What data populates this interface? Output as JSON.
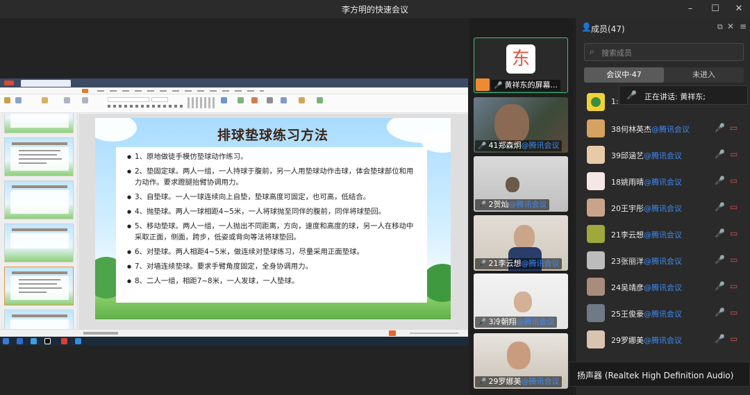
{
  "window": {
    "title": "李方明的快速会议",
    "minimize": "–",
    "maximize": "☐",
    "close": "✕"
  },
  "presentation": {
    "slide_title": "排球垫球练习方法",
    "bullets": [
      "1、原地做徒手模仿垫球动作练习。",
      "2、垫固定球。两人一组，一人持球于腹前，另一人用垫球动作击球，体会垫球部位和用力动作。要求蹬腿抬臂协调用力。",
      "3、自垫球。一人一球连续向上自垫，垫球高度可固定，也可高，低结合。",
      "4、抛垫球。两人一球相距4~5米，一人将球抛至同伴的腹前，同伴将球垫回。",
      "5、移动垫球。两人一组，一人抛出不同距离，方向，速度和高度的球，另一人在移动中采取正面，侧面，跨步，低姿或背向等法将球垫回。",
      "6、对垫球。两人相距4~5米，做连续对垫球练习，尽量采用正面垫球。",
      "7、对墙连续垫球。要求手臂角度固定，全身协调用力。",
      "8、二人一组，相距7~8米，一人发球，一人垫球。"
    ]
  },
  "video_tiles": [
    {
      "name": "黄祥东的屏幕...",
      "avatar_char": "东",
      "mic": "on",
      "active": true
    },
    {
      "name": "41郑森炯",
      "suffix": "@腾讯会议",
      "mic": "muted"
    },
    {
      "name": "2贺灿",
      "suffix": "@腾讯会议",
      "mic": "on"
    },
    {
      "name": "21李云想",
      "suffix": "@腾讯会议",
      "mic": "muted"
    },
    {
      "name": "3冷朝翔",
      "suffix": "@腾讯会议",
      "mic": "muted"
    },
    {
      "name": "29罗娜美",
      "suffix": "@腾讯会议",
      "mic": "muted"
    }
  ],
  "members_panel": {
    "title": "成员(47)",
    "search_placeholder": "搜索成员",
    "tab_in_meeting": "会议中·47",
    "tab_not_joined": "未进入",
    "speaking_now": "正在讲话: 黄祥东;",
    "first_row_fragment": "1:",
    "members": [
      {
        "name": "38何林英杰",
        "suffix": "@腾讯会议",
        "mic": "on",
        "video": "off"
      },
      {
        "name": "39邱涵艺",
        "suffix": "@腾讯会议",
        "mic": "on",
        "video": "off"
      },
      {
        "name": "18姚雨晴",
        "suffix": "@腾讯会议",
        "mic": "muted",
        "video": "off"
      },
      {
        "name": "20王宇彤",
        "suffix": "@腾讯会议",
        "mic": "muted",
        "video": "off"
      },
      {
        "name": "21李云想",
        "suffix": "@腾讯会议",
        "mic": "muted",
        "video": "off"
      },
      {
        "name": "23张丽洋",
        "suffix": "@腾讯会议",
        "mic": "muted",
        "video": "off"
      },
      {
        "name": "24吴靖彦",
        "suffix": "@腾讯会议",
        "mic": "muted",
        "video": "off"
      },
      {
        "name": "25王俊豪",
        "suffix": "@腾讯会议",
        "mic": "muted",
        "video": "off"
      },
      {
        "name": "29罗娜美",
        "suffix": "@腾讯会议",
        "mic": "muted",
        "video": "off"
      }
    ]
  },
  "speaker_tooltip": "扬声器 (Realtek High Definition Audio)",
  "colors": {
    "accent_blue": "#3e8cf7",
    "active_green": "#3ec47a",
    "muted_red": "#d9534f"
  }
}
